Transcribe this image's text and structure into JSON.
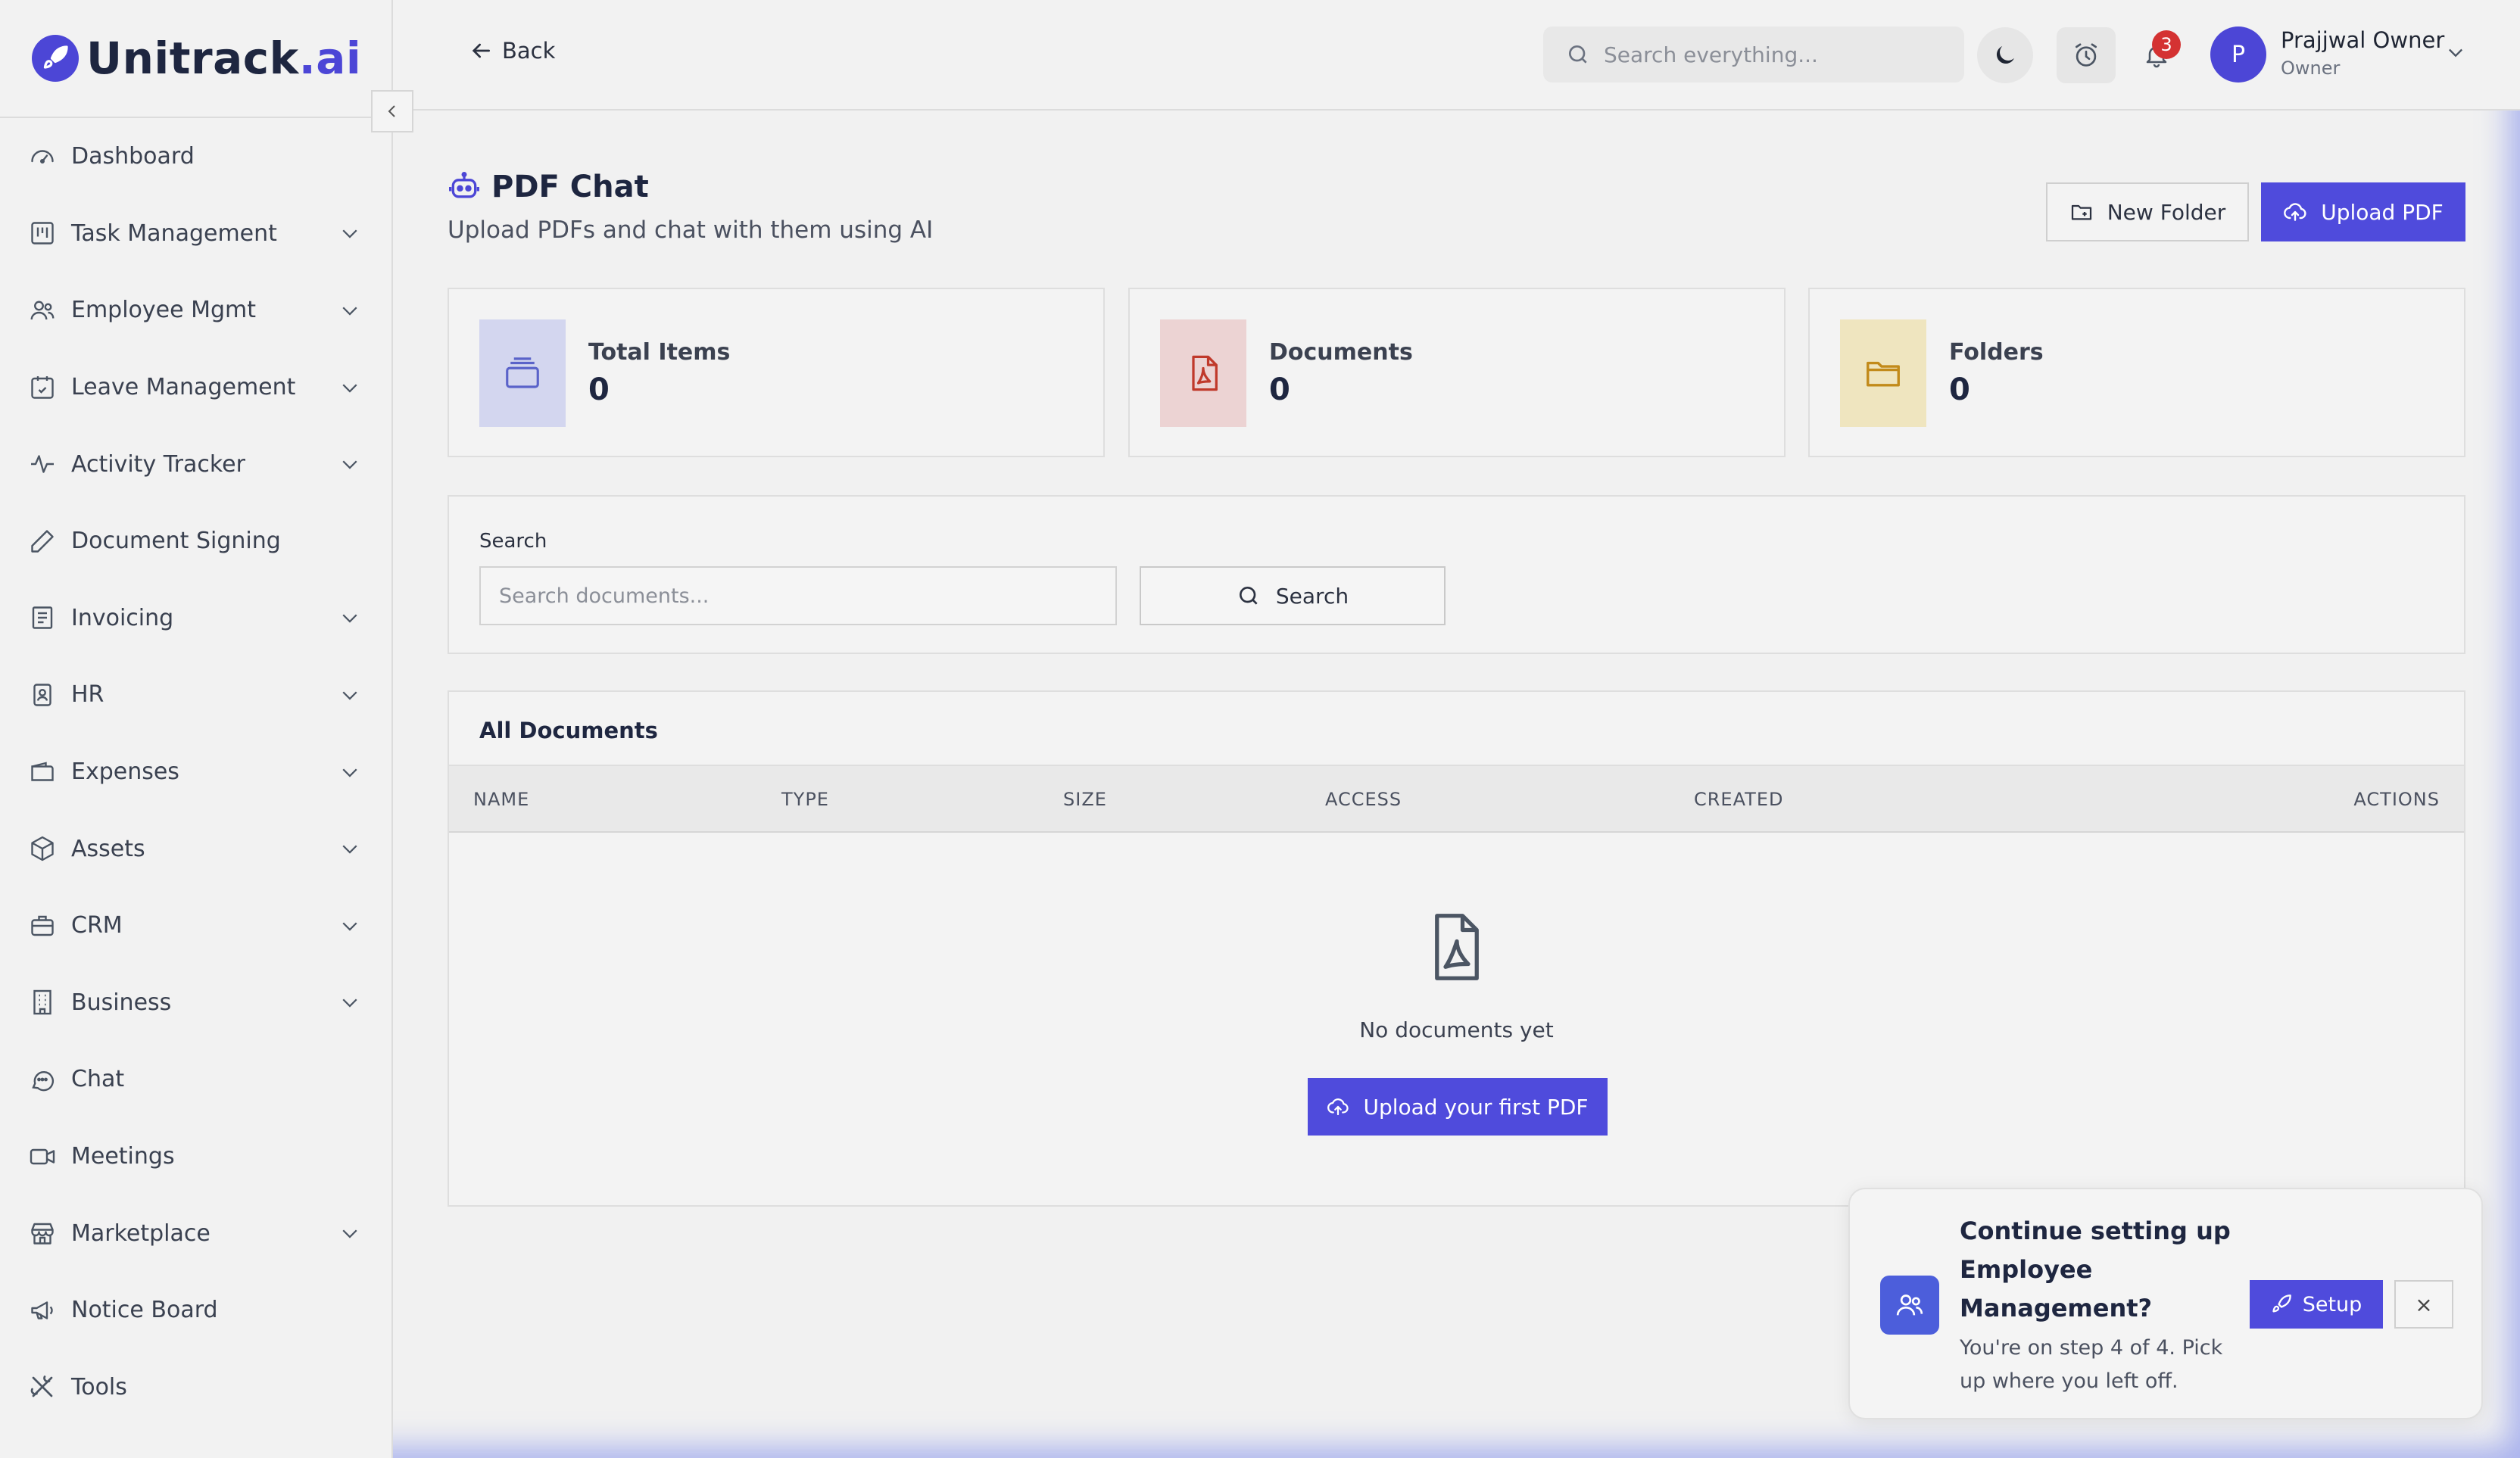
{
  "app": {
    "logo_text_main": "Unitrack",
    "logo_text_suffix": ".ai",
    "brand_color": "#4c46d6"
  },
  "sidebar": {
    "items": [
      {
        "label": "Dashboard",
        "icon": "gauge-icon",
        "has_submenu": false
      },
      {
        "label": "Task Management",
        "icon": "kanban-icon",
        "has_submenu": true
      },
      {
        "label": "Employee Mgmt",
        "icon": "users-icon",
        "has_submenu": true
      },
      {
        "label": "Leave Management",
        "icon": "calendar-check-icon",
        "has_submenu": true
      },
      {
        "label": "Activity Tracker",
        "icon": "activity-icon",
        "has_submenu": true
      },
      {
        "label": "Document Signing",
        "icon": "pen-icon",
        "has_submenu": false
      },
      {
        "label": "Invoicing",
        "icon": "receipt-icon",
        "has_submenu": true
      },
      {
        "label": "HR",
        "icon": "badge-icon",
        "has_submenu": true
      },
      {
        "label": "Expenses",
        "icon": "wallet-icon",
        "has_submenu": true
      },
      {
        "label": "Assets",
        "icon": "box-icon",
        "has_submenu": true
      },
      {
        "label": "CRM",
        "icon": "briefcase-icon",
        "has_submenu": true
      },
      {
        "label": "Business",
        "icon": "building-icon",
        "has_submenu": true
      },
      {
        "label": "Chat",
        "icon": "chat-icon",
        "has_submenu": false
      },
      {
        "label": "Meetings",
        "icon": "video-icon",
        "has_submenu": false
      },
      {
        "label": "Marketplace",
        "icon": "store-icon",
        "has_submenu": true
      },
      {
        "label": "Notice Board",
        "icon": "megaphone-icon",
        "has_submenu": false
      },
      {
        "label": "Tools",
        "icon": "tools-icon",
        "has_submenu": false
      }
    ]
  },
  "topbar": {
    "back_label": "Back",
    "search_placeholder": "Search everything...",
    "notification_count": "3",
    "user": {
      "initial": "P",
      "name": "Prajjwal Owner",
      "role": "Owner"
    }
  },
  "page": {
    "title": "PDF Chat",
    "subtitle": "Upload PDFs and chat with them using AI",
    "new_folder_label": "New Folder",
    "upload_pdf_label": "Upload PDF"
  },
  "stats": [
    {
      "label": "Total Items",
      "value": "0",
      "icon": "stack-icon",
      "bg": "#d3d6ef",
      "fg": "#5a63c9"
    },
    {
      "label": "Documents",
      "value": "0",
      "icon": "pdf-file-icon",
      "bg": "#ecd3d3",
      "fg": "#c0392b"
    },
    {
      "label": "Folders",
      "value": "0",
      "icon": "folder-icon",
      "bg": "#efe5bf",
      "fg": "#c28a1a"
    }
  ],
  "search": {
    "label": "Search",
    "placeholder": "Search documents...",
    "button_label": "Search"
  },
  "documents": {
    "heading": "All Documents",
    "columns": [
      "NAME",
      "TYPE",
      "SIZE",
      "ACCESS",
      "CREATED",
      "ACTIONS"
    ],
    "empty_text": "No documents yet",
    "empty_button_label": "Upload your first PDF"
  },
  "toast": {
    "title": "Continue setting up Employee Management?",
    "body": "You're on step 4 of 4. Pick up where you left off.",
    "setup_label": "Setup",
    "close_label": "×"
  }
}
